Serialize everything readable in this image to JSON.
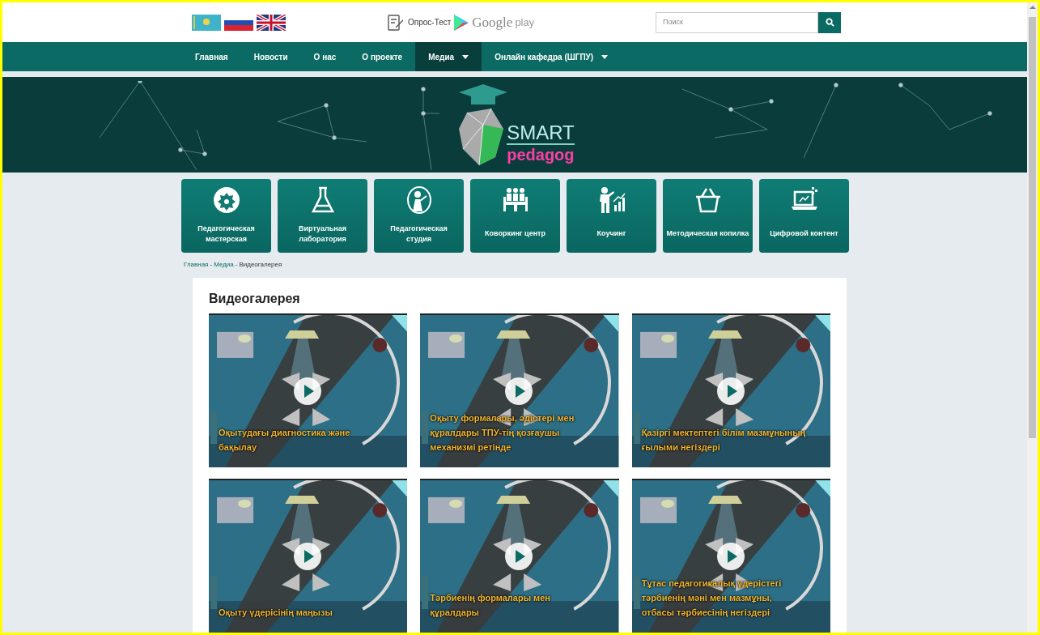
{
  "header": {
    "languages": [
      {
        "kind": "kz",
        "selected": false
      },
      {
        "kind": "ru",
        "selected": false
      },
      {
        "kind": "en",
        "selected": false
      }
    ],
    "survey_link": "Опрос-Тест",
    "store_link": {
      "brand": "Google",
      "suffix": "play"
    },
    "search": {
      "placeholder": "Поиск"
    }
  },
  "nav": [
    {
      "label": "Главная",
      "selected": false,
      "dropdown": false
    },
    {
      "label": "Новости",
      "selected": false,
      "dropdown": false
    },
    {
      "label": "О нас",
      "selected": false,
      "dropdown": false
    },
    {
      "label": "О проекте",
      "selected": false,
      "dropdown": false
    },
    {
      "label": "Медиа",
      "selected": true,
      "dropdown": true
    },
    {
      "label": "Онлайн кафедра (ШГПУ)",
      "selected": false,
      "dropdown": true
    }
  ],
  "banner": {
    "logo_top": "SMART",
    "logo_bottom": "pedagog"
  },
  "tiles": [
    {
      "kind": "gear",
      "label": "Педагогическая мастерская"
    },
    {
      "kind": "flask",
      "label": "Виртуальная лаборатория"
    },
    {
      "kind": "teacher",
      "label": "Педагогическая студия"
    },
    {
      "kind": "meeting",
      "label": "Коворкинг центр"
    },
    {
      "kind": "coach",
      "label": "Коучинг"
    },
    {
      "kind": "basket",
      "label": "Методическая копилка"
    },
    {
      "kind": "laptop",
      "label": "Цифровой контент"
    }
  ],
  "breadcrumb": [
    {
      "kind": "link",
      "label": "Главная"
    },
    {
      "kind": "separator",
      "label": "-"
    },
    {
      "kind": "link",
      "label": "Медиа"
    },
    {
      "kind": "separator",
      "label": "-"
    },
    {
      "kind": "current",
      "label": "Видеогалерея"
    }
  ],
  "gallery": {
    "title": "Видеогалерея",
    "videos": [
      {
        "title": "Оқытудағы диагностика және бақылау"
      },
      {
        "title": "Оқыту формалары, әдістері мен құралдары ТПУ-тің қозғаушы механизмі ретінде"
      },
      {
        "title": "Қазіргі мектептегі білім мазмұнының ғылыми негіздері"
      },
      {
        "title": "Оқыту үдерісінің маңызы"
      },
      {
        "title": "Тәрбиенің формалары мен құралдары"
      },
      {
        "title": "Тұтас педагогикалық үдерістегі тәрбиенің мәні мен мазмұны, отбасы тәрбиесінің негіздері"
      }
    ]
  }
}
